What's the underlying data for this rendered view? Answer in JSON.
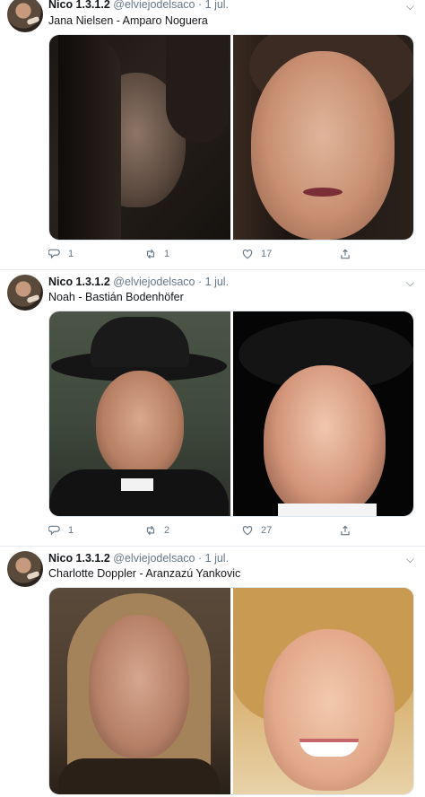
{
  "tweets": [
    {
      "author": "Nico 1.3.1.2",
      "handle": "@elviejodelsaco",
      "sep": "·",
      "date": "1 jul.",
      "text": "Jana Nielsen - Amparo Noguera",
      "replies": "1",
      "retweets": "1",
      "likes": "17"
    },
    {
      "author": "Nico 1.3.1.2",
      "handle": "@elviejodelsaco",
      "sep": "·",
      "date": "1 jul.",
      "text": "Noah - Bastián Bodenhöfer",
      "replies": "1",
      "retweets": "2",
      "likes": "27"
    },
    {
      "author": "Nico 1.3.1.2",
      "handle": "@elviejodelsaco",
      "sep": "·",
      "date": "1 jul.",
      "text": "Charlotte Doppler - Aranzazú Yankovic"
    }
  ],
  "icons": {
    "reply": "reply-icon",
    "retweet": "retweet-icon",
    "like": "heart-icon",
    "share": "share-icon",
    "menu": "chevron-down-icon"
  },
  "colors": {
    "muted": "#657786",
    "text": "#14171a",
    "border": "#e6ecf0"
  }
}
